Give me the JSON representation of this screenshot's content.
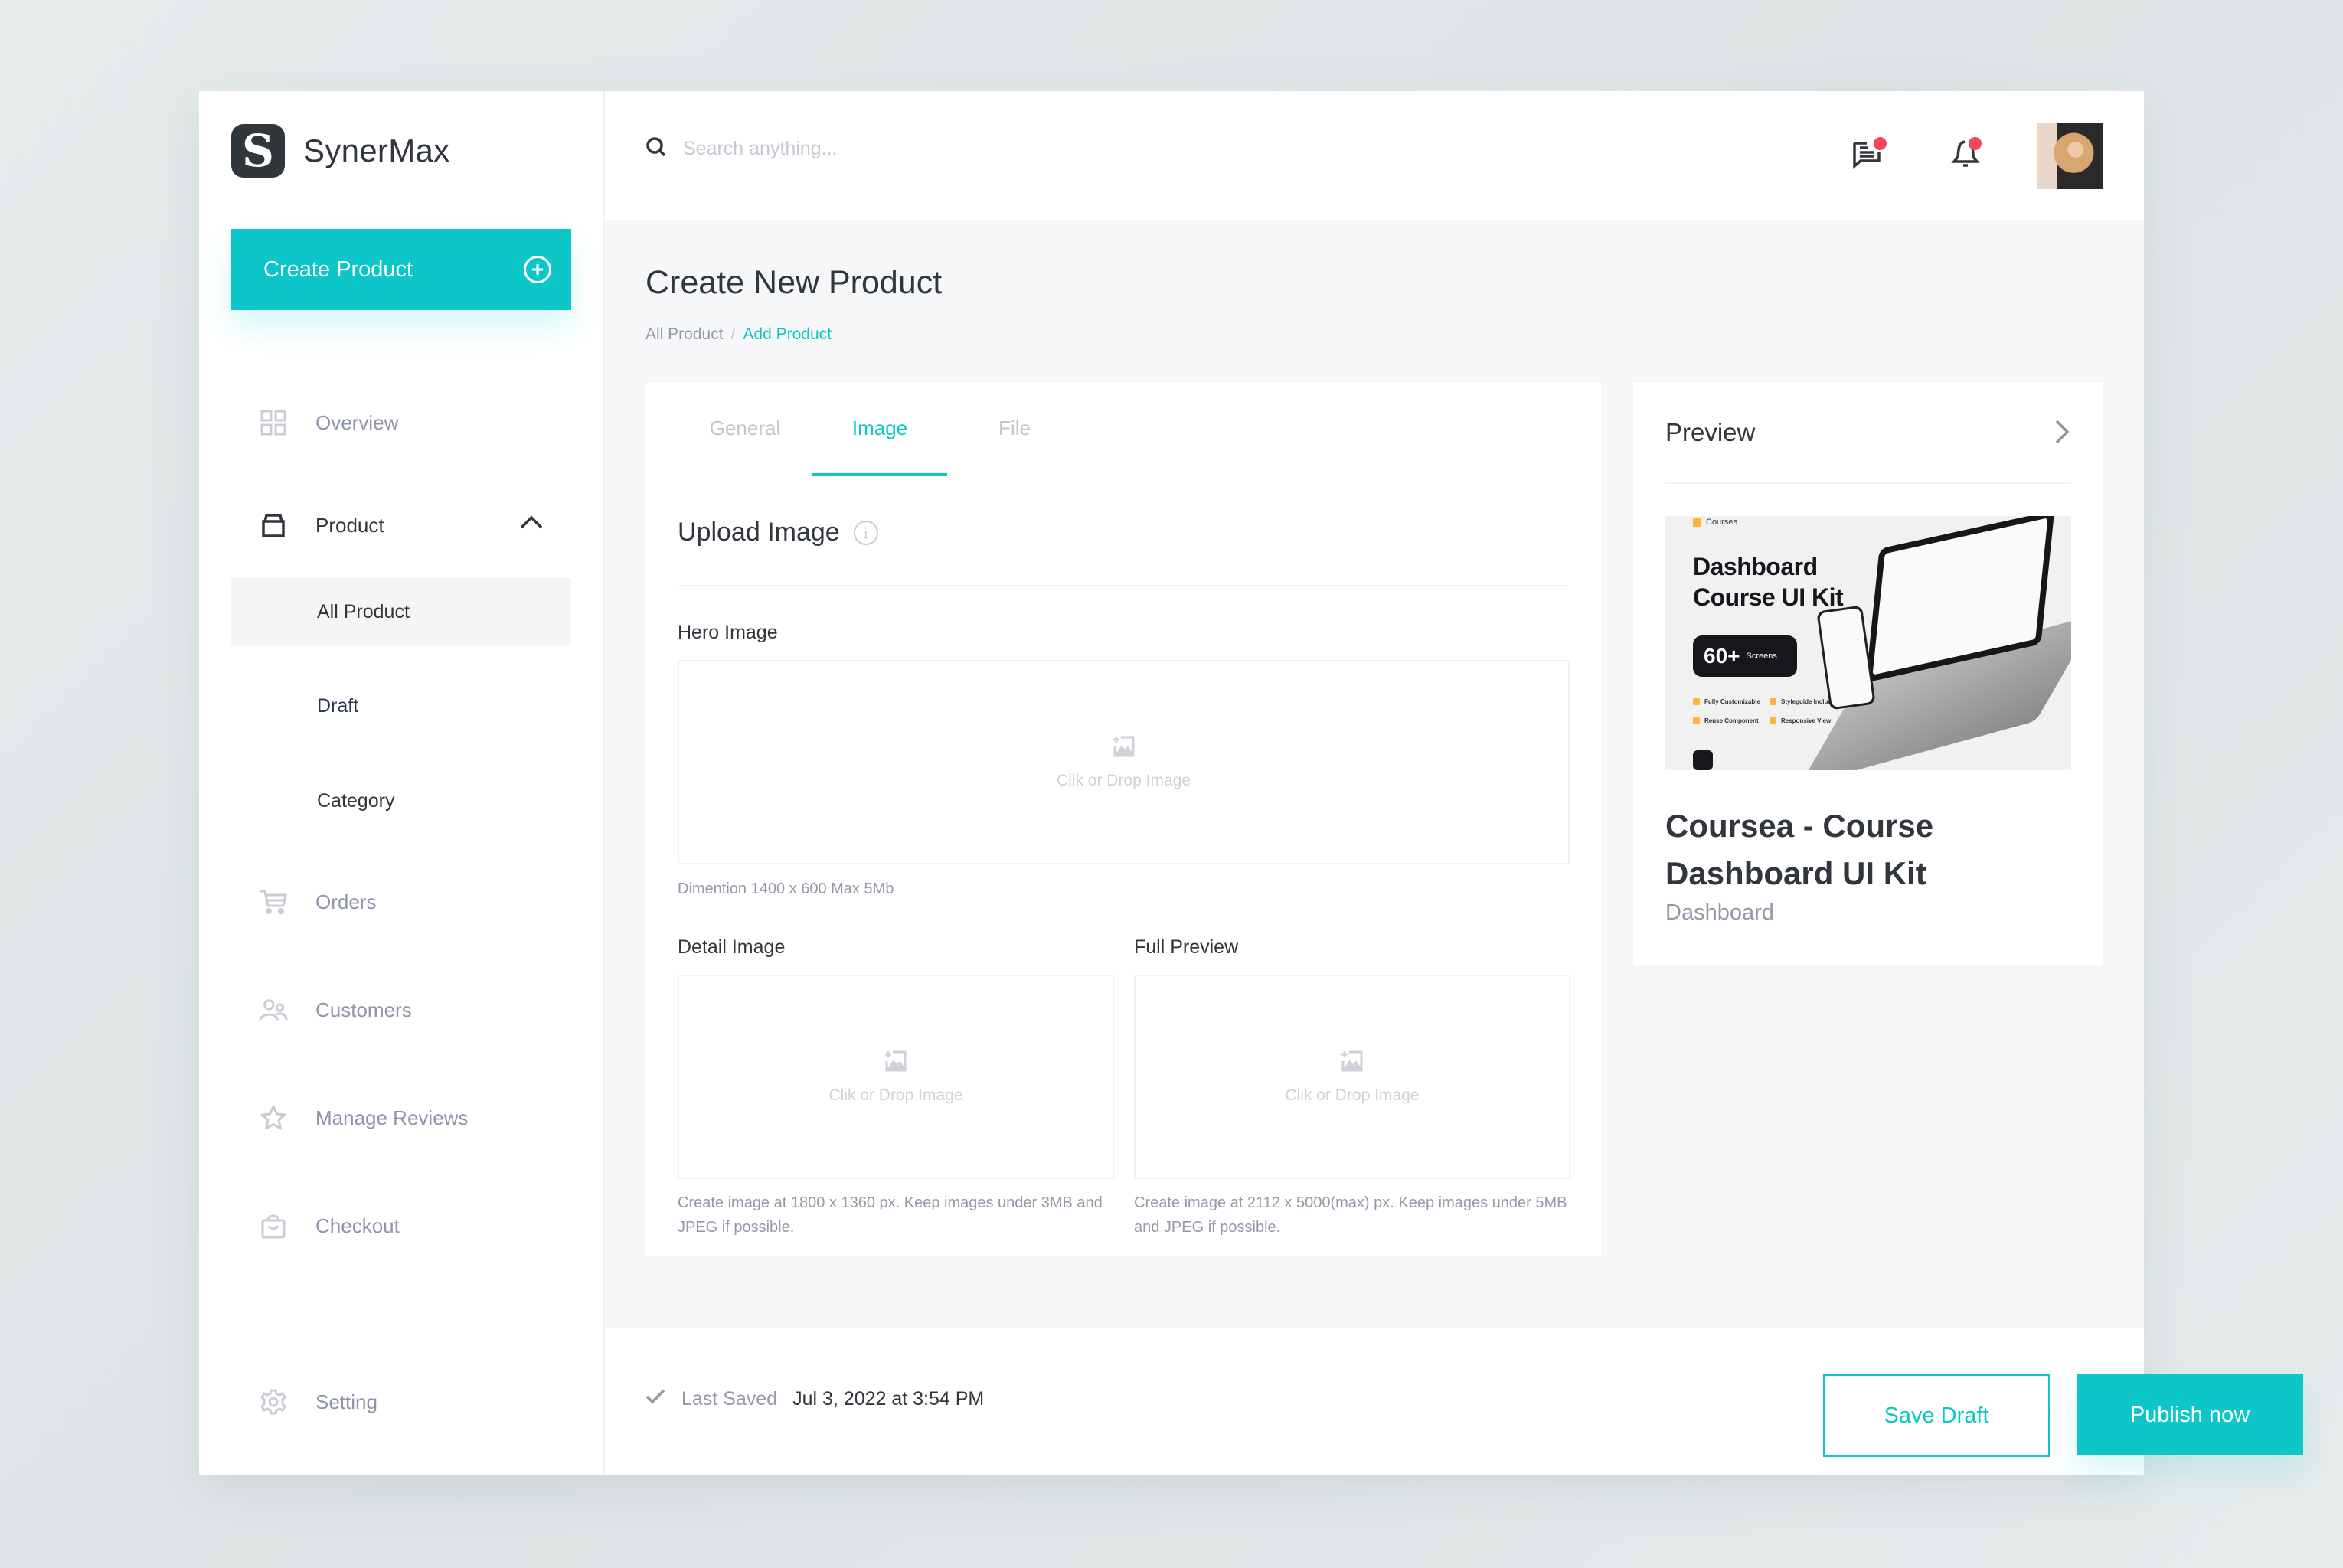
{
  "app": {
    "name": "SynerMax",
    "logo_letter": "S"
  },
  "sidebar": {
    "create_button": {
      "label": "Create Product",
      "icon": "plus-circle-icon"
    },
    "items": [
      {
        "label": "Overview",
        "icon": "grid-icon"
      },
      {
        "label": "Product",
        "icon": "box-icon",
        "expanded": true,
        "children": [
          {
            "label": "All Product",
            "selected": true
          },
          {
            "label": "Draft"
          },
          {
            "label": "Category"
          }
        ]
      },
      {
        "label": "Orders",
        "icon": "cart-icon"
      },
      {
        "label": "Customers",
        "icon": "users-icon"
      },
      {
        "label": "Manage Reviews",
        "icon": "star-icon"
      },
      {
        "label": "Checkout",
        "icon": "bag-icon"
      }
    ],
    "setting": {
      "label": "Setting",
      "icon": "gear-icon"
    }
  },
  "header": {
    "search": {
      "placeholder": "Search anything...",
      "value": ""
    },
    "messages": {
      "icon": "message-icon",
      "has_unread": true
    },
    "notifications": {
      "icon": "bell-icon",
      "has_unread": true
    },
    "avatar": {
      "icon": "user-avatar"
    }
  },
  "page": {
    "title": "Create New Product",
    "breadcrumb": [
      {
        "label": "All Product"
      },
      {
        "label": "Add Product",
        "current": true
      }
    ],
    "breadcrumb_separator": "/"
  },
  "editor": {
    "tabs": [
      {
        "label": "General"
      },
      {
        "label": "Image",
        "active": true
      },
      {
        "label": "File"
      }
    ],
    "section_title": "Upload Image",
    "info_glyph": "i",
    "hero": {
      "label": "Hero Image",
      "drop_text": "Clik or Drop Image",
      "hint": "Dimention 1400 x 600 Max 5Mb"
    },
    "detail": {
      "label": "Detail Image",
      "drop_text": "Clik or Drop Image",
      "hint": "Create image at 1800 x 1360 px. Keep images under 3MB and JPEG if possible."
    },
    "full_preview": {
      "label": "Full Preview",
      "drop_text": "Clik or Drop Image",
      "hint": "Create image at 2112 x 5000(max) px. Keep images under 5MB and JPEG if possible."
    }
  },
  "preview": {
    "title": "Preview",
    "thumbnail": {
      "brand": "Coursea",
      "headline_1": "Dashboard",
      "headline_2": "Course UI Kit",
      "badge_number": "60+",
      "badge_text": "Screens",
      "features": [
        "Fully Customizable",
        "Styleguide Included",
        "Reuse Component",
        "Responsive View"
      ]
    },
    "product_name": "Coursea - Course Dashboard UI Kit",
    "category": "Dashboard"
  },
  "footer": {
    "last_saved_label": "Last Saved",
    "last_saved_value": "Jul 3, 2022 at 3:54 PM",
    "save_draft_label": "Save Draft",
    "publish_label": "Publish now"
  },
  "colors": {
    "accent": "#0cc6c8",
    "text_dark": "#30363c",
    "text_muted": "#9499a8",
    "badge_red": "#f2475a",
    "page_bg": "#f6f7f9"
  }
}
